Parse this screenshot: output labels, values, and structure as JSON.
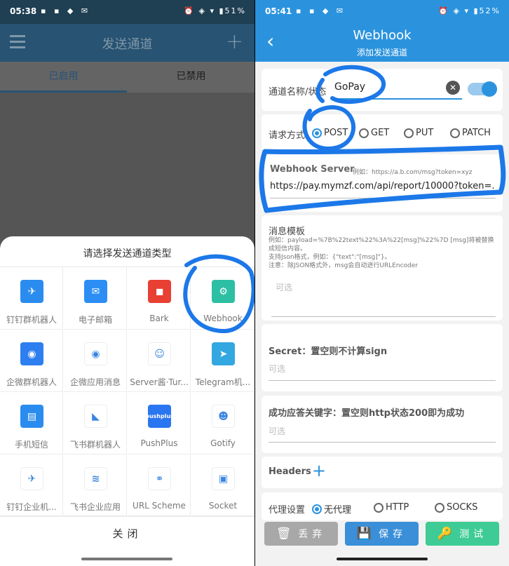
{
  "left": {
    "status": {
      "time": "05:38",
      "icons": "▪ ▪ ◆ ✉",
      "right": "⏰ ◈ ▾ ▮51%"
    },
    "toolbar": {
      "title": "发送通道",
      "plus": "+"
    },
    "tabs": [
      "已启用",
      "已禁用"
    ],
    "sheet": {
      "title": "请选择发送通道类型",
      "items": [
        {
          "label": "钉钉群机器人",
          "icon": "dingtalk-icon",
          "color": "#2b8cf0",
          "glyph": "✈"
        },
        {
          "label": "电子邮箱",
          "icon": "email-icon",
          "color": "#2c8ef4",
          "glyph": "✉"
        },
        {
          "label": "Bark",
          "icon": "bark-icon",
          "color": "#e84032",
          "glyph": "◼"
        },
        {
          "label": "Webhook",
          "icon": "webhook-icon",
          "color": "#2cbfa4",
          "glyph": "⚙"
        },
        {
          "label": "企微群机器人",
          "icon": "wecom-bot-icon",
          "color": "#2d7ff0",
          "glyph": "◉"
        },
        {
          "label": "企微应用消息",
          "icon": "wecom-app-icon",
          "color": "#ffffff",
          "glyph": "◉"
        },
        {
          "label": "Server酱·Tur...",
          "icon": "serverchan-icon",
          "color": "#ffffff",
          "glyph": "☺"
        },
        {
          "label": "Telegram机...",
          "icon": "telegram-icon",
          "color": "#33a7e0",
          "glyph": "➤"
        },
        {
          "label": "手机短信",
          "icon": "sms-icon",
          "color": "#2b8cf0",
          "glyph": "▤"
        },
        {
          "label": "飞书群机器人",
          "icon": "feishu-bot-icon",
          "color": "#ffffff",
          "glyph": "◣"
        },
        {
          "label": "PushPlus",
          "icon": "pushplus-icon",
          "color": "#2a75f0",
          "glyph": "pushplus"
        },
        {
          "label": "Gotify",
          "icon": "gotify-icon",
          "color": "#ffffff",
          "glyph": "☻"
        },
        {
          "label": "钉钉企业机...",
          "icon": "dingtalk-corp-icon",
          "color": "#ffffff",
          "glyph": "✈"
        },
        {
          "label": "飞书企业应用",
          "icon": "feishu-app-icon",
          "color": "#ffffff",
          "glyph": "≋"
        },
        {
          "label": "URL Scheme",
          "icon": "url-scheme-icon",
          "color": "#ffffff",
          "glyph": "⚭"
        },
        {
          "label": "Socket",
          "icon": "socket-icon",
          "color": "#ffffff",
          "glyph": "▣"
        }
      ],
      "close": "关闭"
    }
  },
  "right": {
    "status": {
      "time": "05:41",
      "icons": "▪ ▪ ◆ ✉",
      "right": "⏰ ◈ ▾ ▮52%"
    },
    "toolbar": {
      "title": "Webhook",
      "subtitle": "添加发送通道"
    },
    "channel": {
      "label": "通道名称/状态",
      "value": "GoPay"
    },
    "method": {
      "label": "请求方式",
      "options": [
        "POST",
        "GET",
        "PUT",
        "PATCH"
      ],
      "selected": "POST"
    },
    "server": {
      "label": "Webhook Server",
      "hint": "例如：https://a.b.com/msg?token=xyz",
      "value": "https://pay.mymzf.com/api/report/10000?token=."
    },
    "template": {
      "label": "消息模板",
      "help1": "例如：payload=%7B%22text%22%3A%22[msg]%22%7D [msg]将被替换成短信内容。",
      "help2": "支持Json格式，例如：{\"text\":\"[msg]\"}。",
      "help3": "注意：除JSON格式外，msg会自动进行URLEncoder",
      "placeholder": "可选"
    },
    "secret": {
      "label": "Secret：置空则不计算sign",
      "placeholder": "可选"
    },
    "success": {
      "label": "成功应答关键字：置空则http状态200即为成功",
      "placeholder": "可选"
    },
    "headers": {
      "label": "Headers",
      "plus": "+"
    },
    "proxy": {
      "label": "代理设置",
      "options": [
        "无代理",
        "HTTP",
        "SOCKS"
      ],
      "selected": "无代理"
    },
    "buttons": {
      "discard": "丢弃",
      "save": "保存",
      "test": "测试"
    }
  },
  "colors": {
    "accent": "#2b93de",
    "annotation": "#1c78e8"
  }
}
